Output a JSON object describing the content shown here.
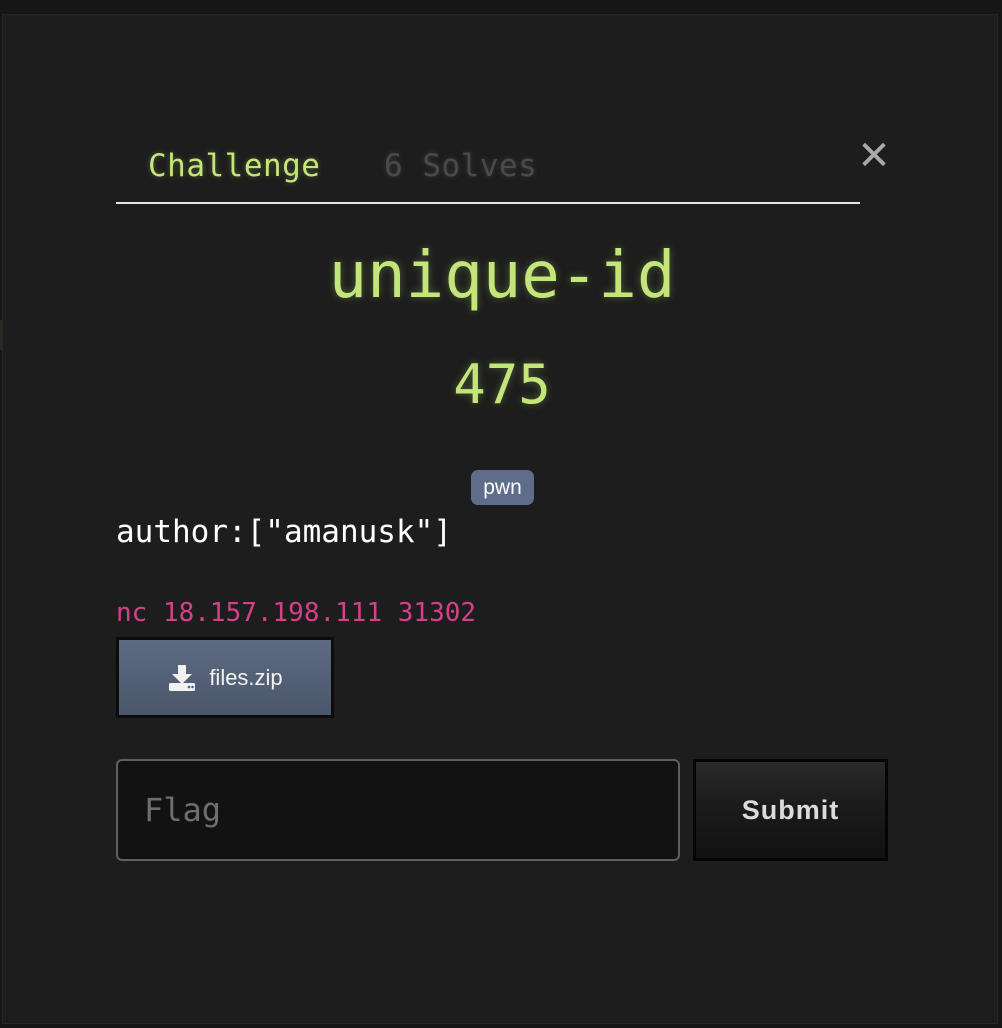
{
  "tabs": {
    "challenge": "Challenge",
    "solves": "6 Solves"
  },
  "close_glyph": "✕",
  "challenge": {
    "name": "unique-id",
    "points": "475",
    "tag": "pwn",
    "author": "author:[\"amanusk\"]",
    "connection": "nc 18.157.198.111 31302"
  },
  "file": {
    "label": "files.zip",
    "icon": "download-icon"
  },
  "flag_form": {
    "placeholder": "Flag",
    "value": "",
    "submit_label": "Submit"
  },
  "colors": {
    "accent": "#c3e57a",
    "connection": "#d5408a",
    "tag_bg": "#5e6d8a",
    "background": "#1d1d1d"
  }
}
